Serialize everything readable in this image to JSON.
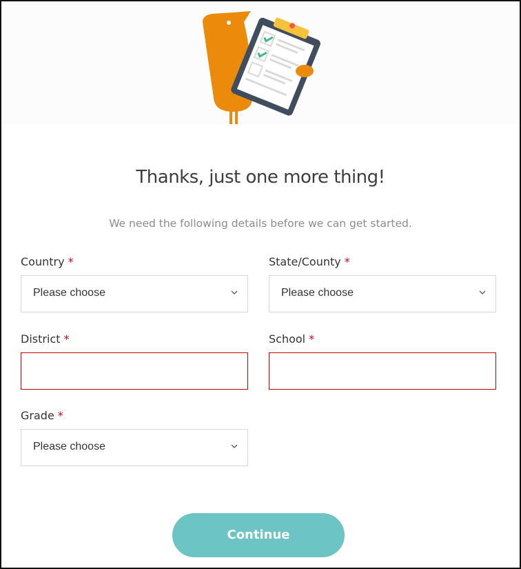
{
  "illustration": {
    "icon": "bird-holding-clipboard-illustration",
    "colors": {
      "bird": "#ec8a0c",
      "clipboard_frame": "#3f4d5e",
      "clip": "#f7c23b",
      "check": "#42b984"
    }
  },
  "header": {
    "title": "Thanks, just one more thing!",
    "subtitle": "We need the following details before we can get started."
  },
  "form": {
    "required_marker": "*",
    "country": {
      "label": "Country",
      "value": "Please choose"
    },
    "state": {
      "label": "State/County",
      "value": "Please choose"
    },
    "district": {
      "label": "District",
      "value": ""
    },
    "school": {
      "label": "School",
      "value": ""
    },
    "grade": {
      "label": "Grade",
      "value": "Please choose"
    }
  },
  "actions": {
    "continue_label": "Continue"
  },
  "colors": {
    "accent": "#6cc4c4",
    "required": "#d0021b",
    "error_border": "#c80000"
  }
}
